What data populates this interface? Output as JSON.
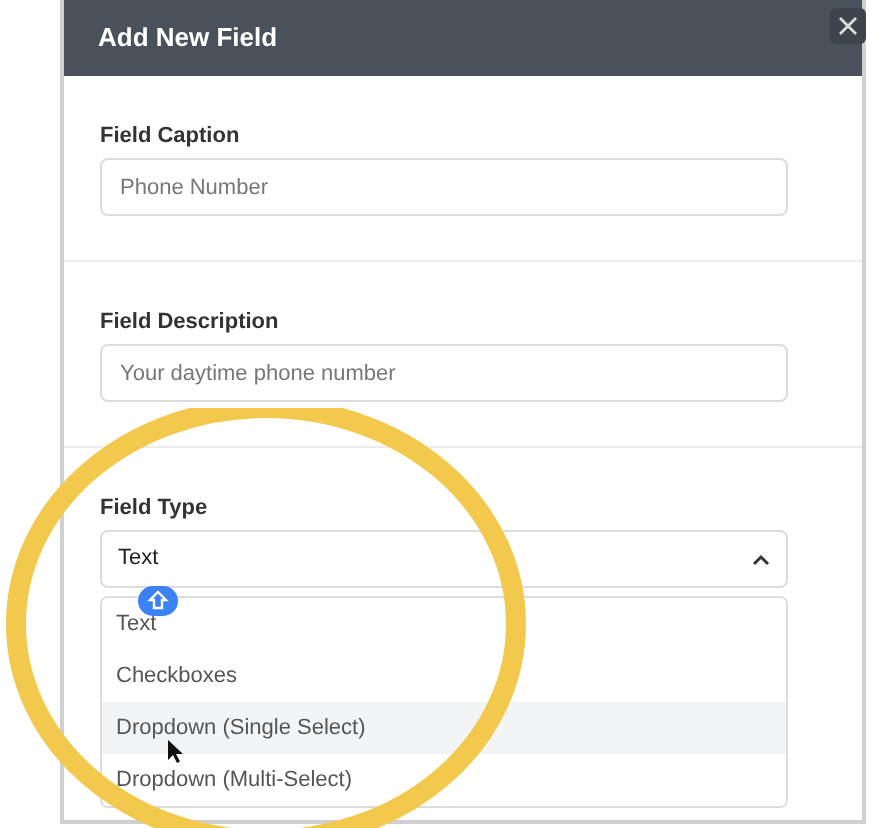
{
  "dialog": {
    "title": "Add New Field"
  },
  "fields": [
    {
      "kind": "input",
      "label": "Field Caption",
      "placeholder": "Phone Number"
    },
    {
      "kind": "input",
      "label": "Field Description",
      "placeholder": "Your daytime phone number"
    },
    {
      "kind": "select",
      "label": "Field Type",
      "value": "Text",
      "expanded": true,
      "options": [
        {
          "label": "Text",
          "highlighted": false
        },
        {
          "label": "Checkboxes",
          "highlighted": false
        },
        {
          "label": "Dropdown (Single Select)",
          "highlighted": true
        },
        {
          "label": "Dropdown (Multi-Select)",
          "highlighted": false
        }
      ]
    }
  ]
}
